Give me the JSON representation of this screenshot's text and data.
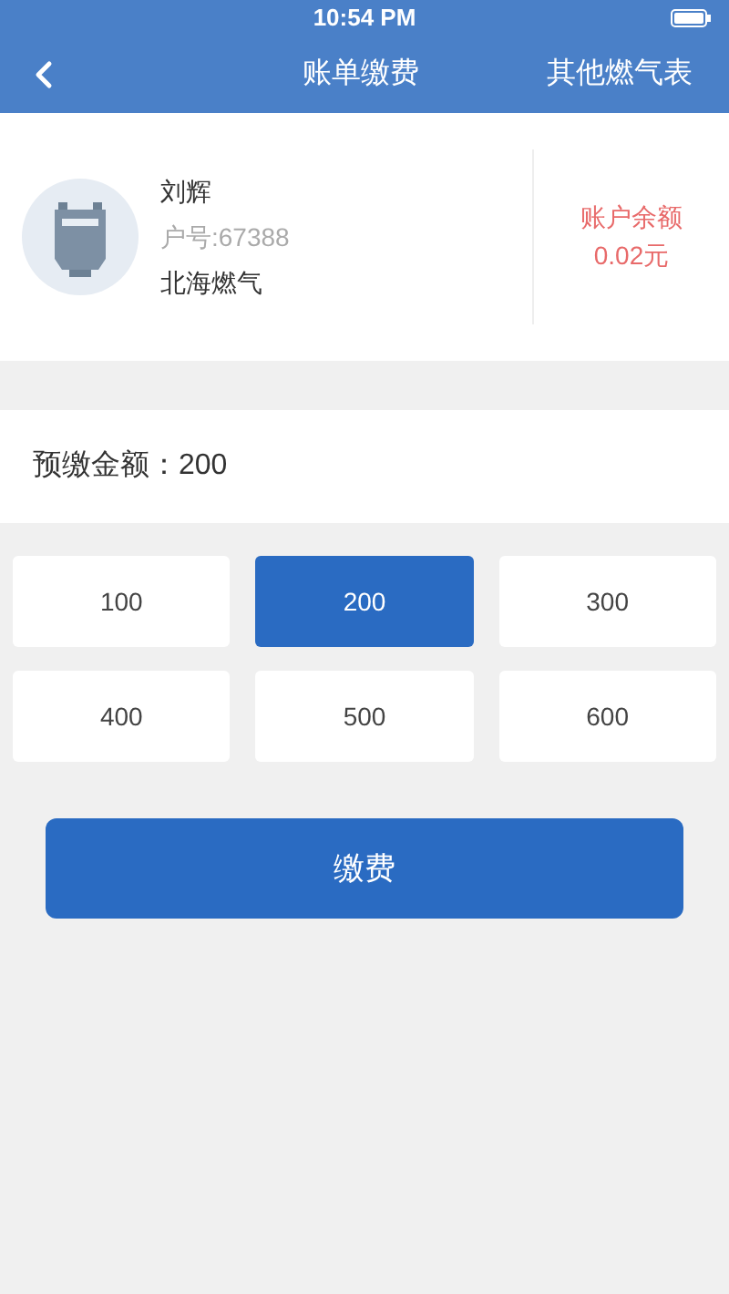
{
  "status_bar": {
    "time": "10:54 PM"
  },
  "nav": {
    "title": "账单缴费",
    "action": "其他燃气表"
  },
  "account": {
    "name": "刘辉",
    "account_no": "户号:67388",
    "company": "北海燃气",
    "balance_label": "账户余额",
    "balance": "0.02元"
  },
  "amount": {
    "label": "预缴金额：",
    "value": "200"
  },
  "options": [
    {
      "label": "100",
      "selected": false
    },
    {
      "label": "200",
      "selected": true
    },
    {
      "label": "300",
      "selected": false
    },
    {
      "label": "400",
      "selected": false
    },
    {
      "label": "500",
      "selected": false
    },
    {
      "label": "600",
      "selected": false
    }
  ],
  "pay_button": "缴费"
}
